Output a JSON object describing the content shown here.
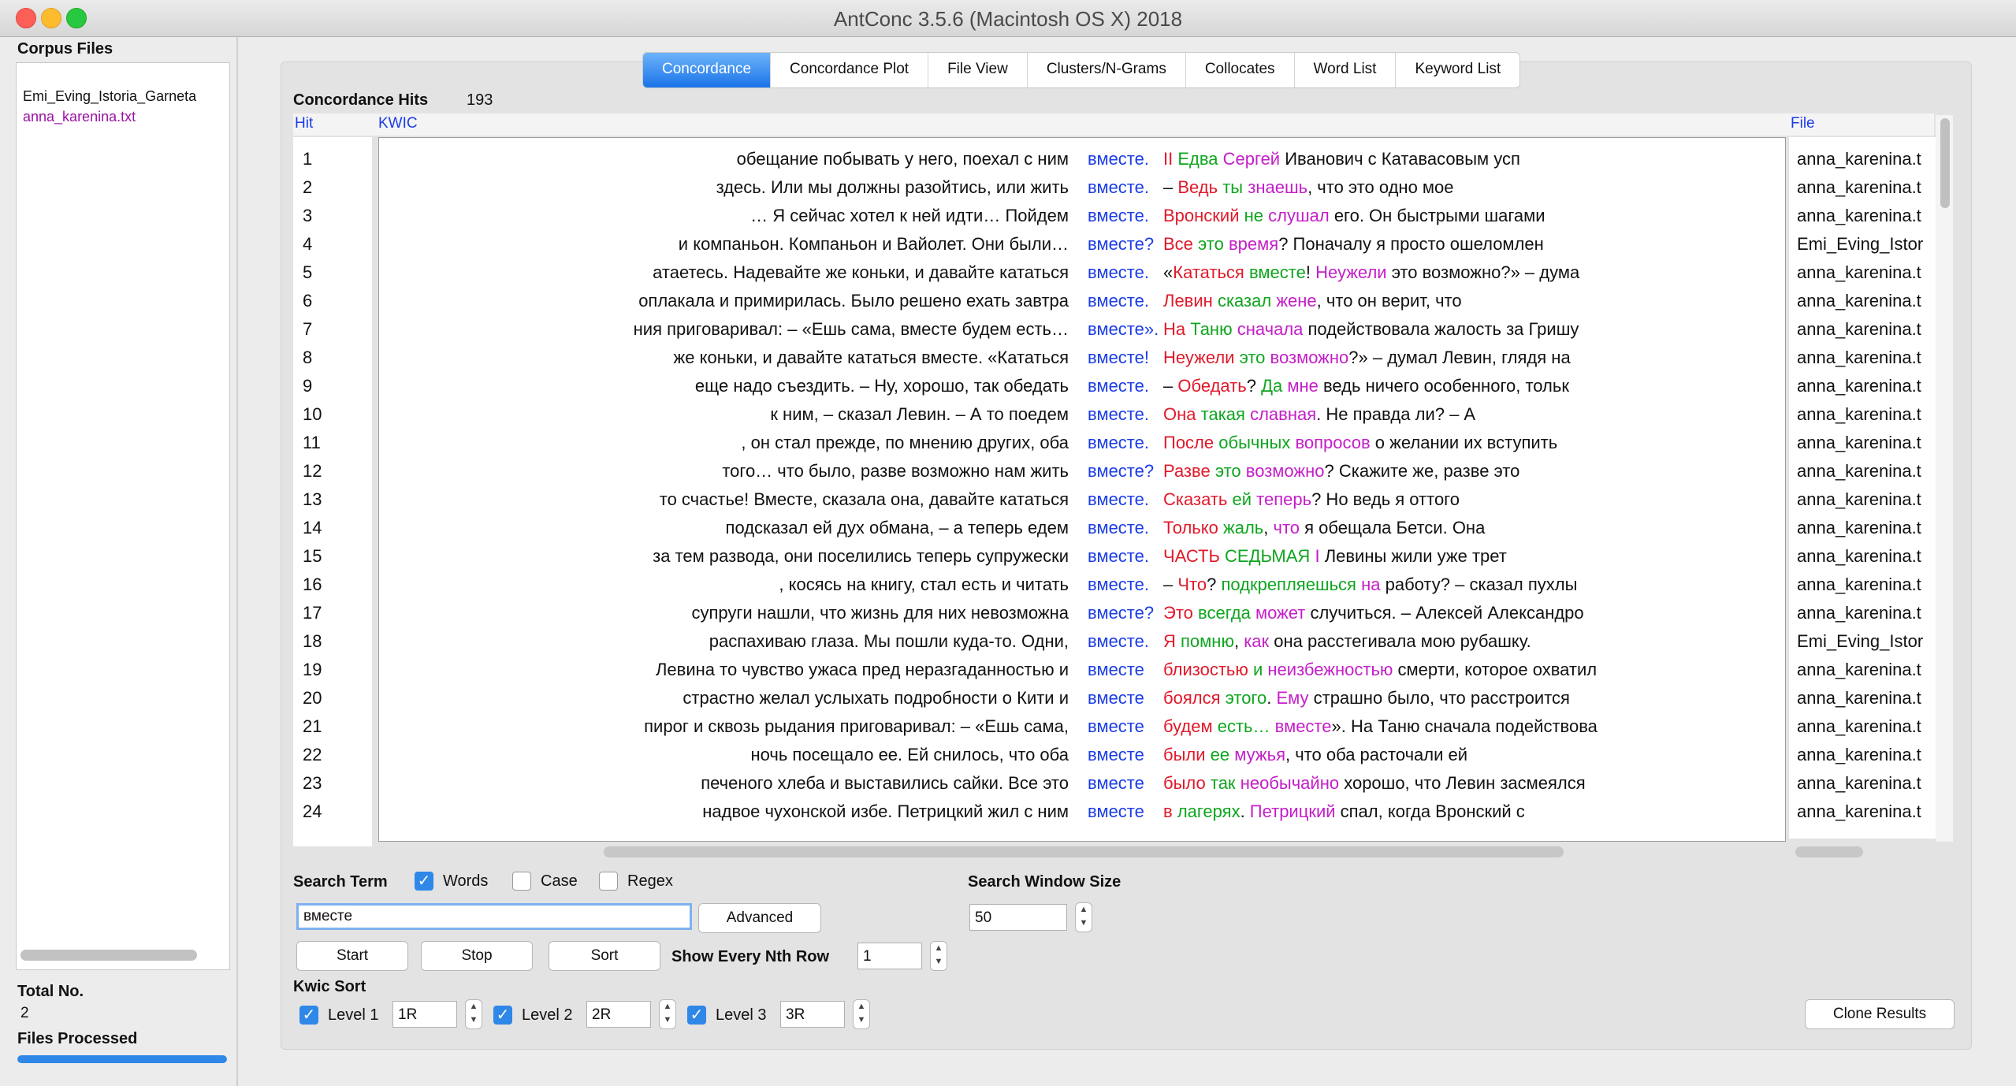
{
  "window": {
    "title": "AntConc 3.5.6 (Macintosh OS X) 2018"
  },
  "sidebar": {
    "title": "Corpus Files",
    "files": [
      "Emi_Eving_Istoria_Garneta",
      "anna_karenina.txt"
    ],
    "total_label": "Total No.",
    "total_value": "2",
    "files_processed_label": "Files Processed",
    "progress": 1.0
  },
  "tabs": [
    "Concordance",
    "Concordance Plot",
    "File View",
    "Clusters/N-Grams",
    "Collocates",
    "Word List",
    "Keyword List"
  ],
  "concordance": {
    "hits_label": "Concordance Hits",
    "hits_value": "193",
    "col_hit": "Hit",
    "col_kwic": "KWIC",
    "col_file": "File",
    "rows": [
      {
        "n": "1",
        "left": "обещание побывать у него, поехал с ним",
        "node": "вместе.",
        "right": [
          {
            "t": "    "
          },
          {
            "t": "II",
            "c": "c-red"
          },
          {
            "t": "   "
          },
          {
            "t": "Едва",
            "c": "c-green"
          },
          {
            "t": " "
          },
          {
            "t": "Сергей",
            "c": "c-mag"
          },
          {
            "t": " Иванович с Катавасовым усп"
          }
        ],
        "file": "anna_karenina.t"
      },
      {
        "n": "2",
        "left": "здесь. Или мы должны разойтись, или жить",
        "node": "вместе.",
        "right": [
          {
            "t": " – "
          },
          {
            "t": "Ведь",
            "c": "c-red"
          },
          {
            "t": " "
          },
          {
            "t": "ты",
            "c": "c-green"
          },
          {
            "t": " "
          },
          {
            "t": "знаешь",
            "c": "c-mag"
          },
          {
            "t": ", что это одно мое"
          }
        ],
        "file": "anna_karenina.t"
      },
      {
        "n": "3",
        "left": "… Я сейчас хотел к ней идти… Пойдем",
        "node": "вместе.",
        "right": [
          {
            "t": " "
          },
          {
            "t": "Вронский",
            "c": "c-red"
          },
          {
            "t": " "
          },
          {
            "t": "не",
            "c": "c-green"
          },
          {
            "t": " "
          },
          {
            "t": "слушал",
            "c": "c-mag"
          },
          {
            "t": " его. Он быстрыми шагами"
          }
        ],
        "file": "anna_karenina.t"
      },
      {
        "n": "4",
        "left": "и компаньон. Компаньон и Вайолет. Они были…",
        "node": "вместе?",
        "right": [
          {
            "t": " "
          },
          {
            "t": "Все",
            "c": "c-red"
          },
          {
            "t": " "
          },
          {
            "t": "это",
            "c": "c-green"
          },
          {
            "t": " "
          },
          {
            "t": "время",
            "c": "c-mag"
          },
          {
            "t": "?  Поначалу я просто ошеломлен"
          }
        ],
        "file": "Emi_Eving_Istor"
      },
      {
        "n": "5",
        "left": "атаетесь. Надевайте же коньки, и давайте кататься",
        "node": "вместе.",
        "right": [
          {
            "t": " «"
          },
          {
            "t": "Кататься",
            "c": "c-red"
          },
          {
            "t": " "
          },
          {
            "t": "вместе",
            "c": "c-green"
          },
          {
            "t": "! "
          },
          {
            "t": "Неужели",
            "c": "c-mag"
          },
          {
            "t": " это возможно?» – дума"
          }
        ],
        "file": "anna_karenina.t"
      },
      {
        "n": "6",
        "left": "оплакала и примирилась.  Было решено ехать завтра",
        "node": "вместе.",
        "right": [
          {
            "t": " "
          },
          {
            "t": "Левин",
            "c": "c-red"
          },
          {
            "t": " "
          },
          {
            "t": "сказал",
            "c": "c-green"
          },
          {
            "t": " "
          },
          {
            "t": "жене",
            "c": "c-mag"
          },
          {
            "t": ", что он верит, что"
          }
        ],
        "file": "anna_karenina.t"
      },
      {
        "n": "7",
        "left": "ния приговаривал: – «Ешь сама, вместе будем есть…",
        "node": "вместе».",
        "right": [
          {
            "t": "  "
          },
          {
            "t": "На",
            "c": "c-red"
          },
          {
            "t": " "
          },
          {
            "t": "Таню",
            "c": "c-green"
          },
          {
            "t": " "
          },
          {
            "t": "сначала",
            "c": "c-mag"
          },
          {
            "t": " подействовала жалость за Гришу"
          }
        ],
        "file": "anna_karenina.t"
      },
      {
        "n": "8",
        "left": "же коньки, и давайте кататься вместе.  «Кататься",
        "node": "вместе!",
        "right": [
          {
            "t": " "
          },
          {
            "t": "Неужели",
            "c": "c-red"
          },
          {
            "t": " "
          },
          {
            "t": "это",
            "c": "c-green"
          },
          {
            "t": " "
          },
          {
            "t": "возможно",
            "c": "c-mag"
          },
          {
            "t": "?» – думал Левин, глядя на"
          }
        ],
        "file": "anna_karenina.t"
      },
      {
        "n": "9",
        "left": "еще надо съездить. – Ну, хорошо, так обедать",
        "node": "вместе.",
        "right": [
          {
            "t": " – "
          },
          {
            "t": "Обедать",
            "c": "c-red"
          },
          {
            "t": "? "
          },
          {
            "t": "Да",
            "c": "c-green"
          },
          {
            "t": " "
          },
          {
            "t": "мне",
            "c": "c-mag"
          },
          {
            "t": " ведь ничего особенного, тольк"
          }
        ],
        "file": "anna_karenina.t"
      },
      {
        "n": "10",
        "left": "к ним, – сказал Левин. – А то поедем",
        "node": "вместе.",
        "right": [
          {
            "t": " "
          },
          {
            "t": "Она",
            "c": "c-red"
          },
          {
            "t": " "
          },
          {
            "t": "такая",
            "c": "c-green"
          },
          {
            "t": " "
          },
          {
            "t": "славная",
            "c": "c-mag"
          },
          {
            "t": ". Не правда ли? – А"
          }
        ],
        "file": "anna_karenina.t"
      },
      {
        "n": "11",
        "left": ", он стал прежде, по мнению других, оба",
        "node": "вместе.",
        "right": [
          {
            "t": "  "
          },
          {
            "t": "После",
            "c": "c-red"
          },
          {
            "t": " "
          },
          {
            "t": "обычных",
            "c": "c-green"
          },
          {
            "t": " "
          },
          {
            "t": "вопросов",
            "c": "c-mag"
          },
          {
            "t": " о желании их вступить"
          }
        ],
        "file": "anna_karenina.t"
      },
      {
        "n": "12",
        "left": "того… что было, разве возможно нам жить",
        "node": "вместе?",
        "right": [
          {
            "t": " "
          },
          {
            "t": "Разве",
            "c": "c-red"
          },
          {
            "t": " "
          },
          {
            "t": "это",
            "c": "c-green"
          },
          {
            "t": " "
          },
          {
            "t": "возможно",
            "c": "c-mag"
          },
          {
            "t": "? Скажите же, разве это"
          }
        ],
        "file": "anna_karenina.t"
      },
      {
        "n": "13",
        "left": "то счастье! Вместе, сказала она, давайте кататься",
        "node": "вместе.",
        "right": [
          {
            "t": " "
          },
          {
            "t": "Сказать",
            "c": "c-red"
          },
          {
            "t": " "
          },
          {
            "t": "ей",
            "c": "c-green"
          },
          {
            "t": " "
          },
          {
            "t": "теперь",
            "c": "c-mag"
          },
          {
            "t": "? Но ведь я оттого"
          }
        ],
        "file": "anna_karenina.t"
      },
      {
        "n": "14",
        "left": "подсказал ей дух обмана, – а теперь едем",
        "node": "вместе.",
        "right": [
          {
            "t": " "
          },
          {
            "t": "Только",
            "c": "c-red"
          },
          {
            "t": " "
          },
          {
            "t": "жаль",
            "c": "c-green"
          },
          {
            "t": ", "
          },
          {
            "t": "что",
            "c": "c-mag"
          },
          {
            "t": " я обещала Бетси. Она"
          }
        ],
        "file": "anna_karenina.t"
      },
      {
        "n": "15",
        "left": "за тем развода, они поселились теперь супружески",
        "node": "вместе.",
        "right": [
          {
            "t": "    "
          },
          {
            "t": "ЧАСТЬ",
            "c": "c-red"
          },
          {
            "t": " "
          },
          {
            "t": "СЕДЬМАЯ",
            "c": "c-green"
          },
          {
            "t": "    "
          },
          {
            "t": "I",
            "c": "c-mag"
          },
          {
            "t": "   Левины жили уже трет"
          }
        ],
        "file": "anna_karenina.t"
      },
      {
        "n": "16",
        "left": ", косясь на книгу, стал есть и читать",
        "node": "вместе.",
        "right": [
          {
            "t": " – "
          },
          {
            "t": "Что",
            "c": "c-red"
          },
          {
            "t": "? "
          },
          {
            "t": "подкрепляешься",
            "c": "c-green"
          },
          {
            "t": " "
          },
          {
            "t": "на",
            "c": "c-mag"
          },
          {
            "t": " работу? – сказал пухлы"
          }
        ],
        "file": "anna_karenina.t"
      },
      {
        "n": "17",
        "left": "супруги нашли, что жизнь для них невозможна",
        "node": "вместе?",
        "right": [
          {
            "t": " "
          },
          {
            "t": "Это",
            "c": "c-red"
          },
          {
            "t": " "
          },
          {
            "t": "всегда",
            "c": "c-green"
          },
          {
            "t": " "
          },
          {
            "t": "может",
            "c": "c-mag"
          },
          {
            "t": " случиться. – Алексей Александро"
          }
        ],
        "file": "anna_karenina.t"
      },
      {
        "n": "18",
        "left": "распахиваю глаза. Мы пошли куда-то. Одни,",
        "node": "вместе.",
        "right": [
          {
            "t": " "
          },
          {
            "t": "Я",
            "c": "c-red"
          },
          {
            "t": " "
          },
          {
            "t": "помню",
            "c": "c-green"
          },
          {
            "t": ", "
          },
          {
            "t": "как",
            "c": "c-mag"
          },
          {
            "t": " она расстегивала мою рубашку."
          }
        ],
        "file": "Emi_Eving_Istor"
      },
      {
        "n": "19",
        "left": "Левина то чувство ужаса пред неразгаданностью и",
        "node": "вместе",
        "right": [
          {
            "t": " "
          },
          {
            "t": "близостью",
            "c": "c-red"
          },
          {
            "t": " "
          },
          {
            "t": "и",
            "c": "c-green"
          },
          {
            "t": " "
          },
          {
            "t": "неизбежностью",
            "c": "c-mag"
          },
          {
            "t": " смерти, которое охватил"
          }
        ],
        "file": "anna_karenina.t"
      },
      {
        "n": "20",
        "left": "страстно желал услыхать подробности о Кити и",
        "node": "вместе",
        "right": [
          {
            "t": " "
          },
          {
            "t": "боялся",
            "c": "c-red"
          },
          {
            "t": " "
          },
          {
            "t": "этого",
            "c": "c-green"
          },
          {
            "t": ". "
          },
          {
            "t": "Ему",
            "c": "c-mag"
          },
          {
            "t": " страшно было, что расстроится"
          }
        ],
        "file": "anna_karenina.t"
      },
      {
        "n": "21",
        "left": "пирог и сквозь рыдания приговаривал: – «Ешь сама,",
        "node": "вместе",
        "right": [
          {
            "t": " "
          },
          {
            "t": "будем",
            "c": "c-red"
          },
          {
            "t": " "
          },
          {
            "t": "есть…",
            "c": "c-green"
          },
          {
            "t": " "
          },
          {
            "t": "вместе",
            "c": "c-mag"
          },
          {
            "t": "».  На Таню сначала подействова"
          }
        ],
        "file": "anna_karenina.t"
      },
      {
        "n": "22",
        "left": "ночь посещало ее. Ей снилось, что оба",
        "node": "вместе",
        "right": [
          {
            "t": " "
          },
          {
            "t": "были",
            "c": "c-red"
          },
          {
            "t": " "
          },
          {
            "t": "ее",
            "c": "c-green"
          },
          {
            "t": " "
          },
          {
            "t": "мужья",
            "c": "c-mag"
          },
          {
            "t": ", что оба расточали ей"
          }
        ],
        "file": "anna_karenina.t"
      },
      {
        "n": "23",
        "left": "печеного хлеба и выставились сайки. Все это",
        "node": "вместе",
        "right": [
          {
            "t": " "
          },
          {
            "t": "было",
            "c": "c-red"
          },
          {
            "t": " "
          },
          {
            "t": "так",
            "c": "c-green"
          },
          {
            "t": " "
          },
          {
            "t": "необычайно",
            "c": "c-mag"
          },
          {
            "t": " хорошо, что Левин засмеялся"
          }
        ],
        "file": "anna_karenina.t"
      },
      {
        "n": "24",
        "left": "надвое чухонской избе. Петрицкий жил с ним",
        "node": "вместе",
        "right": [
          {
            "t": " "
          },
          {
            "t": "в",
            "c": "c-red"
          },
          {
            "t": " "
          },
          {
            "t": "лагерях",
            "c": "c-green"
          },
          {
            "t": ". "
          },
          {
            "t": "Петрицкий",
            "c": "c-mag"
          },
          {
            "t": " спал, когда Вронский с"
          }
        ],
        "file": "anna_karenina.t"
      }
    ]
  },
  "search": {
    "label": "Search Term",
    "words_label": "Words",
    "words_checked": true,
    "case_label": "Case",
    "case_checked": false,
    "regex_label": "Regex",
    "regex_checked": false,
    "value": "вместе",
    "advanced_label": "Advanced",
    "window_size_label": "Search Window Size",
    "window_size_value": "50",
    "start_label": "Start",
    "stop_label": "Stop",
    "sort_label": "Sort",
    "nth_row_label": "Show Every Nth Row",
    "nth_row_value": "1"
  },
  "kwic_sort": {
    "label": "Kwic Sort",
    "levels": [
      {
        "label": "Level 1",
        "value": "1R",
        "checked": true
      },
      {
        "label": "Level 2",
        "value": "2R",
        "checked": true
      },
      {
        "label": "Level 3",
        "value": "3R",
        "checked": true
      }
    ],
    "clone_label": "Clone Results"
  },
  "icons": {
    "check": "checkmark-icon",
    "stepper": "up-down-stepper-icon"
  },
  "colors": {
    "node": "#1a3ce8",
    "sort1": "#e0192a",
    "sort2": "#0fa51f",
    "sort3": "#c41ec8",
    "accent": "#2f87e8"
  }
}
